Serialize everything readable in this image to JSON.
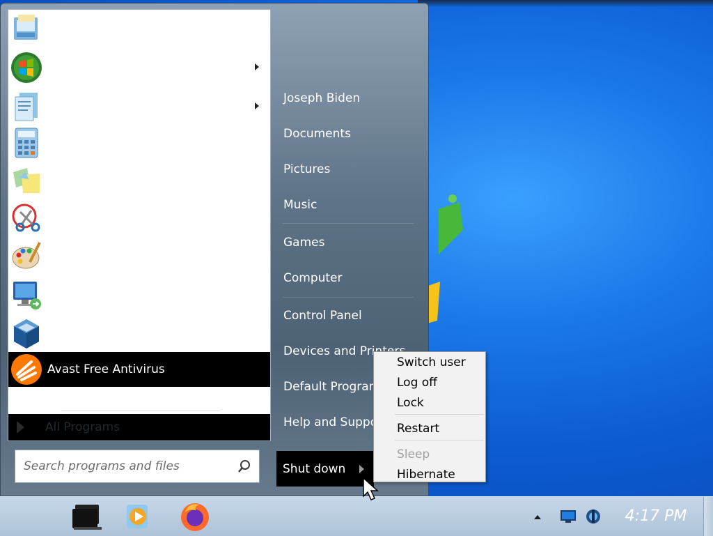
{
  "start_menu": {
    "pinned": [
      {
        "icon": "getting-started-icon",
        "label": ""
      },
      {
        "icon": "windows-media-center-icon",
        "label": "",
        "submenu": true
      },
      {
        "icon": "wordpad-icon",
        "label": "",
        "submenu": true
      },
      {
        "icon": "calculator-icon",
        "label": ""
      },
      {
        "icon": "sticky-notes-icon",
        "label": ""
      },
      {
        "icon": "snipping-tool-icon",
        "label": ""
      },
      {
        "icon": "paint-icon",
        "label": ""
      },
      {
        "icon": "remote-desktop-icon",
        "label": ""
      },
      {
        "icon": "virtualbox-icon",
        "label": ""
      },
      {
        "icon": "avast-icon",
        "label": "Avast Free Antivirus"
      }
    ],
    "all_programs_label": "All Programs",
    "search_placeholder": "Search programs and files",
    "right_items": [
      "Joseph Biden",
      "Documents",
      "Pictures",
      "Music",
      "Games",
      "Computer",
      "Control Panel",
      "Devices and Printers",
      "Default Programs",
      "Help and Support"
    ],
    "shutdown_label": "Shut down"
  },
  "shutdown_menu": {
    "items": [
      {
        "label": "Switch user",
        "enabled": true
      },
      {
        "label": "Log off",
        "enabled": true
      },
      {
        "label": "Lock",
        "enabled": true
      },
      {
        "label": "Restart",
        "enabled": true
      },
      {
        "label": "Sleep",
        "enabled": false
      },
      {
        "label": "Hibernate",
        "enabled": true
      }
    ]
  },
  "taskbar": {
    "pinned": [
      "windows-explorer-icon",
      "windows-media-player-icon",
      "firefox-icon"
    ],
    "tray": [
      "show-hidden-icons-arrow",
      "network-icon",
      "volume-icon"
    ],
    "clock": "4:17 PM"
  },
  "colors": {
    "desktop": "#0c5bd0",
    "highlight": "#000000",
    "taskbar": "#b7c9db"
  }
}
